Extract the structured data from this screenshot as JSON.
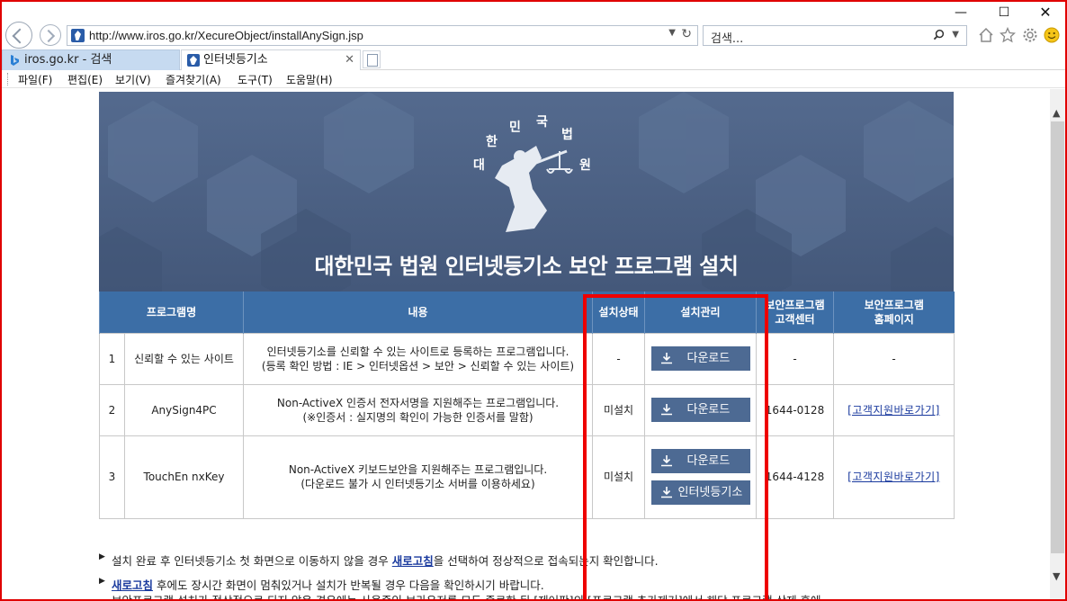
{
  "browser": {
    "url": "http://www.iros.go.kr/XecureObject/installAnySign.jsp",
    "search_placeholder": "검색...",
    "tabs": [
      {
        "label": "iros.go.kr - 검색",
        "active": false
      },
      {
        "label": "인터넷등기소",
        "active": true
      }
    ],
    "menu": [
      "파일(F)",
      "편집(E)",
      "보기(V)",
      "즐겨찾기(A)",
      "도구(T)",
      "도움말(H)"
    ]
  },
  "banner": {
    "title": "대한민국 법원 인터넷등기소 보안 프로그램 설치",
    "emblem_text": [
      "대",
      "한",
      "민",
      "국",
      "법",
      "원"
    ]
  },
  "table": {
    "headers": {
      "name": "프로그램명",
      "content": "내용",
      "status": "설치상태",
      "manage": "설치관리",
      "center_l1": "보안프로그램",
      "center_l2": "고객센터",
      "home_l1": "보안프로그램",
      "home_l2": "홈페이지"
    },
    "rows": [
      {
        "no": "1",
        "name": "신뢰할 수 있는 사이트",
        "desc_l1": "인터넷등기소를 신뢰할 수 있는 사이트로 등록하는 프로그램입니다.",
        "desc_l2": "(등록 확인 방법 : IE > 인터넷옵션 > 보안 > 신뢰할 수 있는 사이트)",
        "status": "-",
        "button": "다운로드",
        "center": "-",
        "home": "-"
      },
      {
        "no": "2",
        "name": "AnySign4PC",
        "desc_l1": "Non-ActiveX 인증서 전자서명을 지원해주는 프로그램입니다.",
        "desc_l2": "(※인증서 : 실지명의 확인이 가능한 인증서를 말함)",
        "status": "미설치",
        "button": "다운로드",
        "center": "1644-0128",
        "home": "[고객지원바로가기]"
      },
      {
        "no": "3",
        "name": "TouchEn nxKey",
        "desc_l1": "Non-ActiveX 키보드보안을 지원해주는 프로그램입니다.",
        "desc_l2": "(다운로드 불가 시 인터넷등기소 서버를 이용하세요)",
        "status": "미설치",
        "button": "다운로드",
        "button2": "인터넷등기소",
        "center": "1644-4128",
        "home": "[고객지원바로가기]"
      }
    ]
  },
  "notes": {
    "n1_pre": "설치 완료 후 인터넷등기소 첫 화면으로 이동하지 않을 경우 ",
    "n1_link": "새로고침",
    "n1_post": "을 선택하여 정상적으로 접속되는지 확인합니다.",
    "n2_link": "새로고침",
    "n2_post": " 후에도 장시간 화면이 멈춰있거나 설치가 반복될 경우 다음을 확인하시기 바랍니다.",
    "n3": "보안프로그램 설치가 정상적으로 되지 않은 경우에는 사용중인 브라우저를 모두 종료한 뒤 [제어판]의 [프로그램 추가제거]에서 해당 프로그램 삭제 후에"
  },
  "colors": {
    "header_blue": "#3c6ea6",
    "button_blue": "#4d6a93",
    "status_red": "#d01010",
    "highlight_red": "#ee0000",
    "banner_bg": "#4f6487"
  }
}
